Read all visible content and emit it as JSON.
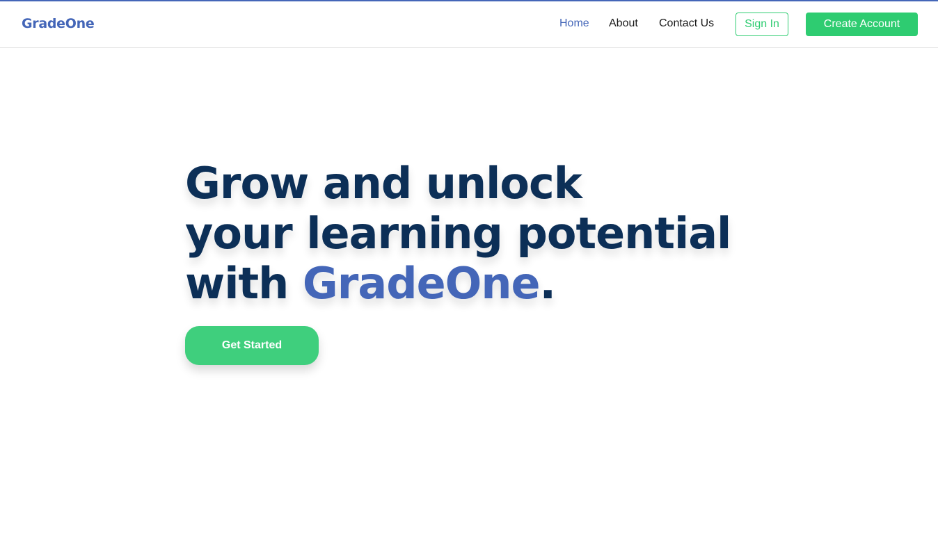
{
  "brand": {
    "name": "GradeOne"
  },
  "nav": {
    "home": "Home",
    "about": "About",
    "contact": "Contact Us",
    "sign_in": "Sign In",
    "create_account": "Create Account"
  },
  "hero": {
    "line1": "Grow and unlock",
    "line2": "your learning potential",
    "line3_prefix": "with ",
    "line3_brand": "GradeOne",
    "line3_suffix": ".",
    "cta": "Get Started"
  },
  "colors": {
    "brand_blue": "#4466b8",
    "heading_navy": "#0c2f57",
    "accent_green": "#2ecc71"
  }
}
